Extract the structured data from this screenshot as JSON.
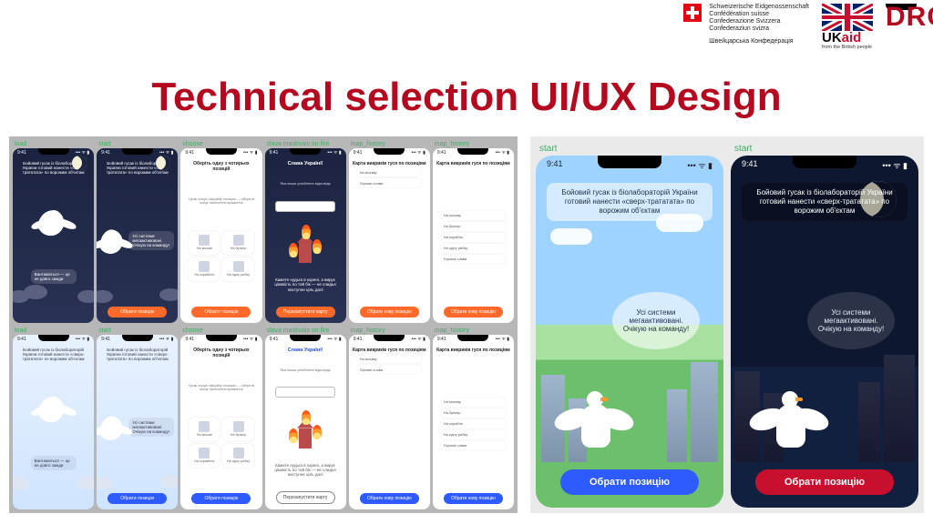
{
  "header": {
    "swiss_lines": [
      "Schweizerische Eidgenossenschaft",
      "Confédération suisse",
      "Confederazione Svizzera",
      "Confederaziun svizra"
    ],
    "swiss_sub": "Швейцарська Конфедерація",
    "ukaid_uk": "UK",
    "ukaid_aid": "aid",
    "ukaid_sub": "from the British people",
    "drc": "DRC"
  },
  "title": "Technical selection UI/UX Design",
  "screen_labels": {
    "load": "load",
    "start": "start",
    "choose": "choose",
    "fire": "slava maskvais on fire",
    "map": "map_history"
  },
  "status_bar": {
    "time": "9:41",
    "icons": "••• ᯤ ▮"
  },
  "copy": {
    "top_msg": "Бойовий гусак із біолабораторій України готовий нанести «сверх-трататата» по ворожим об'єктам",
    "bubble_ready": "Усі системи мегаактивовані. Очікую на команду!",
    "loading": "Вантажиться — це не довго зажди",
    "choose_title": "Оберіть одну з чотирьох позицій",
    "choose_sub": "Гусак очікує офіційну позицію — оберити місце нанесення враження",
    "slava": "Слава Україні!",
    "slava_sub": "Яка ваша улюблена відповідь",
    "map_title": "Карта викриків гуся по позиціям",
    "fire_caption": "Кажете нудьга в корені, а вирує цікавість по той бік — не слидье наступне ціль далі",
    "opts": [
      "На москві",
      "На бункер",
      "На корабель",
      "На одну рибку"
    ],
    "hist": [
      "На москву",
      "На бункер",
      "На корабль",
      "На одну рибку",
      "Героям слава"
    ]
  },
  "buttons": {
    "choose": "Обрати позицію",
    "rechoose": "Перезапустити карту",
    "new_pos": "Обрати нову позицію"
  },
  "colors": {
    "accent_red": "#b4091f",
    "orange": "#ff6a2a",
    "blue": "#2d5bff"
  }
}
